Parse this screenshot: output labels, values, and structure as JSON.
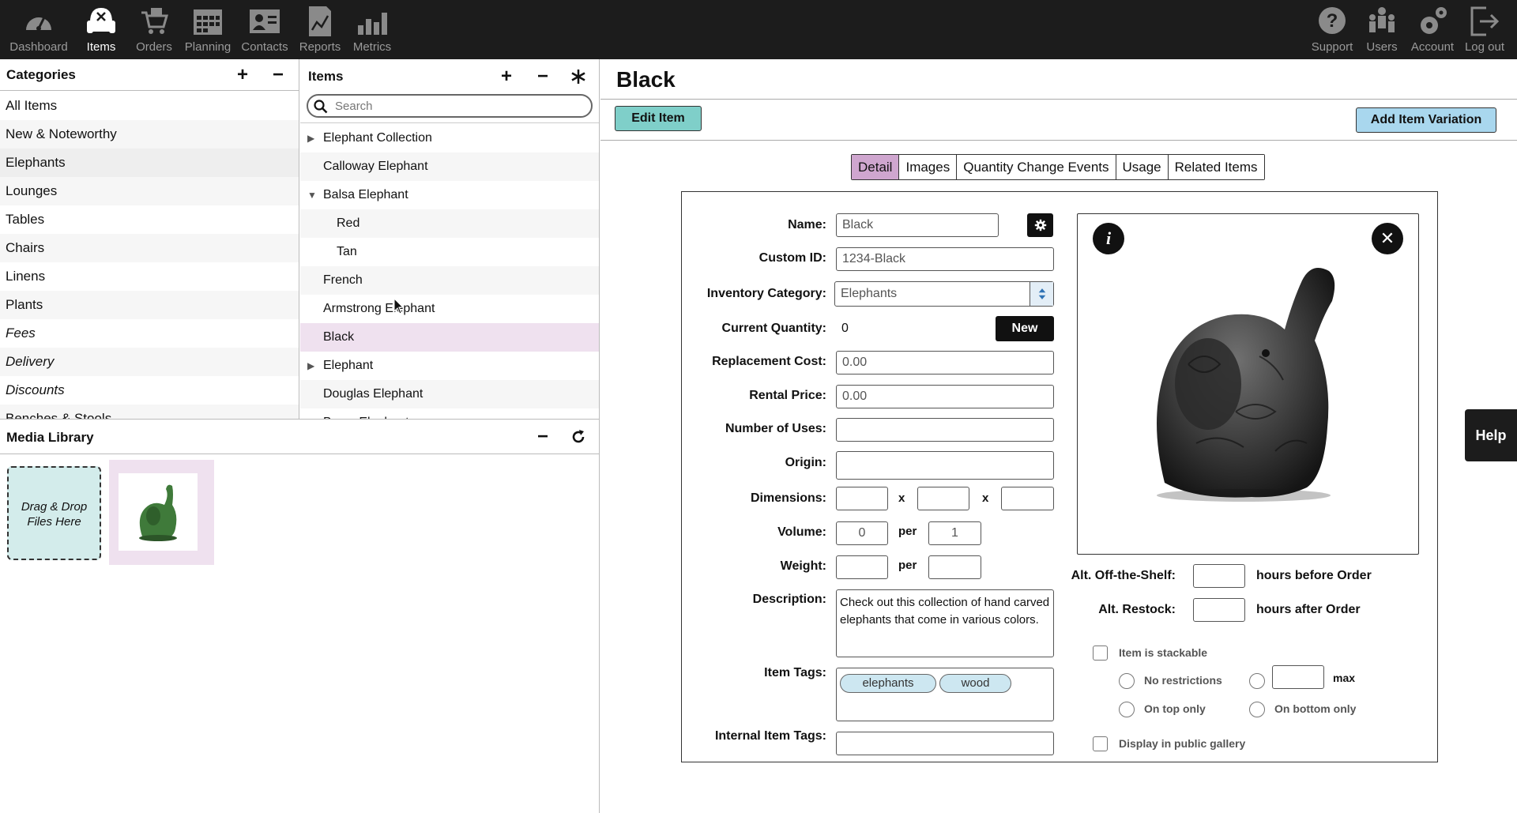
{
  "nav": {
    "left": [
      {
        "label": "Dashboard",
        "icon": "speedometer-icon"
      },
      {
        "label": "Items",
        "icon": "armchair-icon",
        "active": true
      },
      {
        "label": "Orders",
        "icon": "cart-icon"
      },
      {
        "label": "Planning",
        "icon": "calendar-icon"
      },
      {
        "label": "Contacts",
        "icon": "contact-card-icon"
      },
      {
        "label": "Reports",
        "icon": "report-chart-icon"
      },
      {
        "label": "Metrics",
        "icon": "bar-chart-icon"
      }
    ],
    "right": [
      {
        "label": "Support",
        "icon": "question-icon"
      },
      {
        "label": "Users",
        "icon": "users-icon"
      },
      {
        "label": "Account",
        "icon": "gears-icon"
      },
      {
        "label": "Log out",
        "icon": "logout-icon"
      }
    ]
  },
  "categories": {
    "title": "Categories",
    "add": "+",
    "remove": "−",
    "items": [
      {
        "label": "All Items"
      },
      {
        "label": "New & Noteworthy"
      },
      {
        "label": "Elephants",
        "selected": true
      },
      {
        "label": "Lounges"
      },
      {
        "label": "Tables"
      },
      {
        "label": "Chairs"
      },
      {
        "label": "Linens"
      },
      {
        "label": "Plants"
      },
      {
        "label": "Fees",
        "italic": true
      },
      {
        "label": "Delivery",
        "italic": true
      },
      {
        "label": "Discounts",
        "italic": true
      },
      {
        "label": "Benches & Stools"
      }
    ]
  },
  "items": {
    "title": "Items",
    "add": "+",
    "remove": "−",
    "search_placeholder": "Search",
    "rows": [
      {
        "label": "Elephant Collection",
        "expander": "▶"
      },
      {
        "label": "Calloway Elephant"
      },
      {
        "label": "Balsa Elephant",
        "expander": "▼"
      },
      {
        "label": "Red",
        "child": true
      },
      {
        "label": "Tan",
        "child": true
      },
      {
        "label": "French"
      },
      {
        "label": "Armstrong Elephant"
      },
      {
        "label": "Black",
        "selected": true
      },
      {
        "label": "Elephant",
        "expander": "▶"
      },
      {
        "label": "Douglas Elephant"
      },
      {
        "label": "Brass Elephant"
      }
    ]
  },
  "media": {
    "title": "Media Library",
    "minimize": "−",
    "dropzone_text": "Drag & Drop Files Here"
  },
  "detail": {
    "title": "Black",
    "edit_button": "Edit Item",
    "add_variation_button": "Add Item Variation",
    "tabs": [
      {
        "label": "Detail",
        "active": true
      },
      {
        "label": "Images"
      },
      {
        "label": "Quantity Change Events"
      },
      {
        "label": "Usage"
      },
      {
        "label": "Related Items"
      }
    ],
    "form": {
      "name_label": "Name:",
      "name_value": "Black",
      "custom_id_label": "Custom ID:",
      "custom_id_value": "1234-Black",
      "category_label": "Inventory Category:",
      "category_value": "Elephants",
      "quantity_label": "Current Quantity:",
      "quantity_value": "0",
      "new_button": "New",
      "replacement_label": "Replacement Cost:",
      "replacement_value": "0.00",
      "rental_label": "Rental Price:",
      "rental_value": "0.00",
      "uses_label": "Number of Uses:",
      "origin_label": "Origin:",
      "dimensions_label": "Dimensions:",
      "x_sep": "x",
      "volume_label": "Volume:",
      "volume_value": "0",
      "per": "per",
      "volume_per_value": "1",
      "weight_label": "Weight:",
      "description_label": "Description:",
      "description_value": "Check out this collection of hand carved elephants that come in various colors.",
      "tags_label": "Item Tags:",
      "tags": [
        "elephants",
        "wood"
      ],
      "internal_tags_label": "Internal Item Tags:"
    },
    "image_panel": {
      "info": "i",
      "close": "✕"
    },
    "right_form": {
      "off_shelf_label": "Alt. Off-the-Shelf:",
      "off_shelf_suffix": "hours before Order",
      "restock_label": "Alt. Restock:",
      "restock_suffix": "hours after Order",
      "stackable_label": "Item is stackable",
      "no_restrictions": "No restrictions",
      "max_label": "max",
      "on_top_only": "On top only",
      "on_bottom_only": "On bottom only",
      "public_gallery": "Display in public gallery"
    }
  },
  "help_label": "Help",
  "colors": {
    "nav_bg": "#1c1c1c",
    "teal_button": "#7fcfc9",
    "blue_button": "#a9d7ee",
    "tab_active": "#cfa6cf",
    "selected_row": "#efe1ef",
    "tag_bg": "#cde7f1",
    "dropzone_bg": "#d3eceb"
  }
}
